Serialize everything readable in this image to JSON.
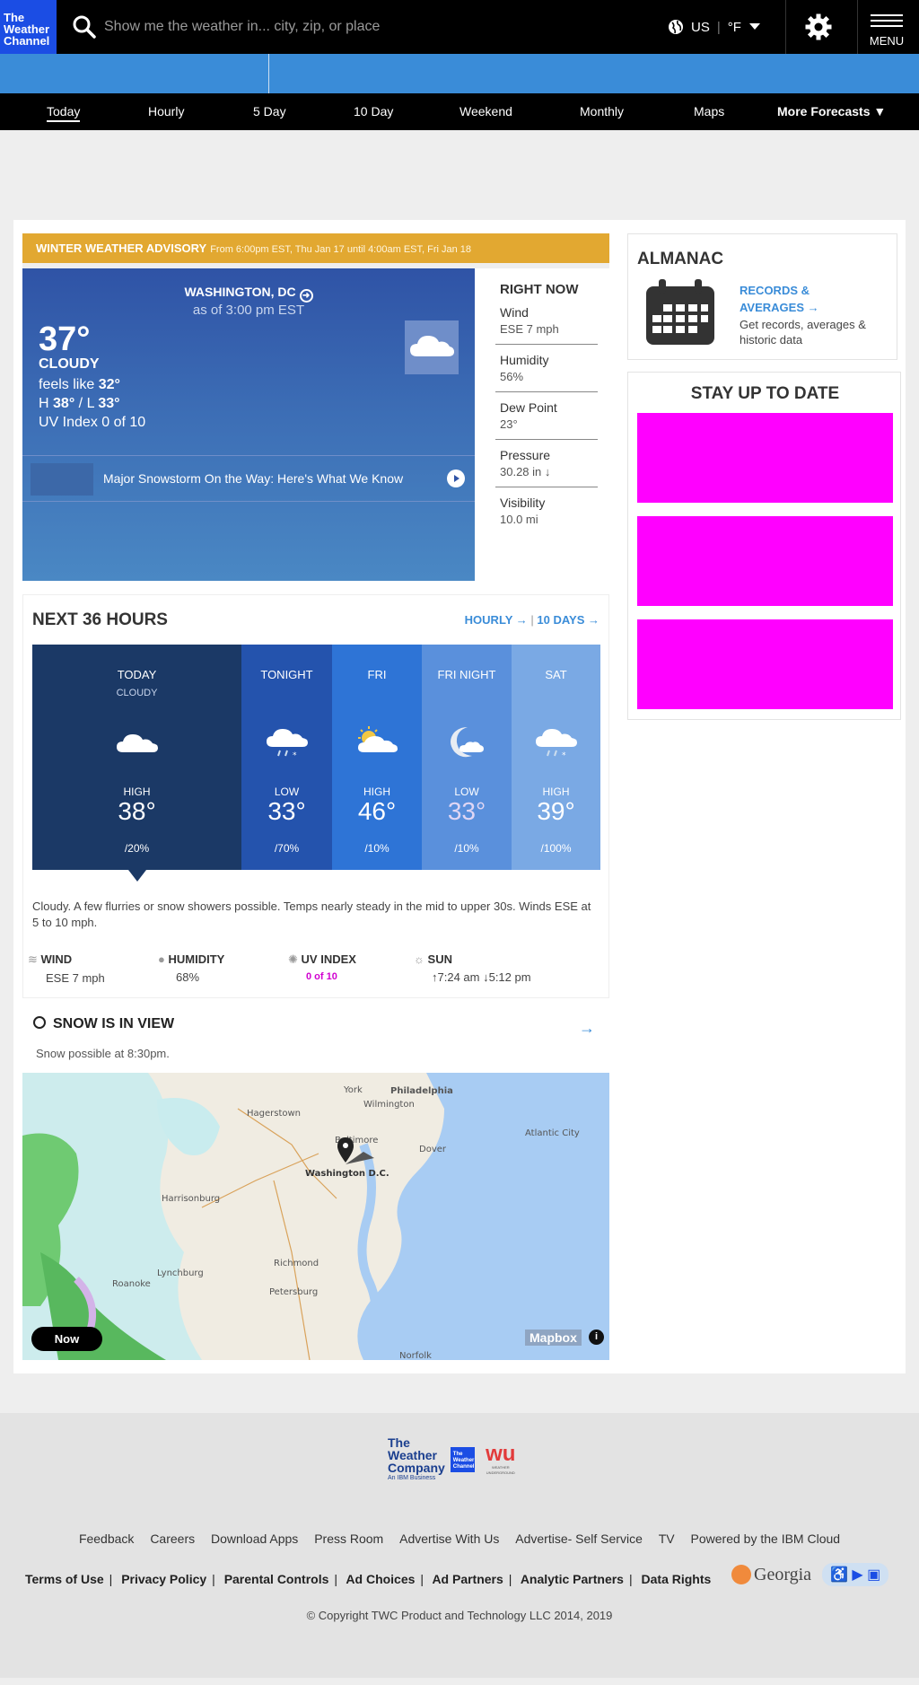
{
  "header": {
    "logo": [
      "The",
      "Weather",
      "Channel"
    ],
    "search_placeholder": "Show me the weather in... city, zip, or place",
    "locale": "US",
    "unit": "°F",
    "menu_label": "MENU"
  },
  "nav": {
    "items": [
      "Today",
      "Hourly",
      "5 Day",
      "10 Day",
      "Weekend",
      "Monthly",
      "Maps",
      "More Forecasts"
    ],
    "active": "Today"
  },
  "advisory": {
    "title": "WINTER WEATHER ADVISORY",
    "detail": "From 6:00pm EST, Thu Jan 17 until 4:00am EST, Fri Jan 18"
  },
  "current": {
    "location": "WASHINGTON, DC",
    "as_of": "as of 3:00 pm EST",
    "temp": "37°",
    "condition": "CLOUDY",
    "feels_like_label": "feels like",
    "feels_like": "32°",
    "high_label": "H",
    "high": "38°",
    "low_label": "L",
    "low": "33°",
    "uv": "UV Index 0 of 10",
    "video_title": "Major Snowstorm On the Way: Here's What We Know",
    "icon": "cloud-icon"
  },
  "right_now": {
    "title": "RIGHT NOW",
    "items": [
      {
        "label": "Wind",
        "value": "ESE 7 mph"
      },
      {
        "label": "Humidity",
        "value": "56%"
      },
      {
        "label": "Dew Point",
        "value": "23°"
      },
      {
        "label": "Pressure",
        "value": "30.28 in ↓"
      },
      {
        "label": "Visibility",
        "value": "10.0 mi"
      }
    ]
  },
  "almanac": {
    "title": "ALMANAC",
    "link": "RECORDS & AVERAGES →",
    "desc": "Get records, averages & historic data"
  },
  "stay": {
    "title": "STAY UP TO DATE"
  },
  "next36": {
    "title": "NEXT 36 HOURS",
    "link_hourly": "HOURLY →",
    "link_10days": "10 DAYS →",
    "periods": [
      {
        "name": "TODAY",
        "condition": "CLOUDY",
        "type": "HIGH",
        "temp": "38°",
        "precip": "20%",
        "color": "#1b3966",
        "icon": "cloud-icon"
      },
      {
        "name": "TONIGHT",
        "condition": "",
        "type": "LOW",
        "temp": "33°",
        "precip": "70%",
        "color": "#2453ad",
        "icon": "snow-cloud-icon"
      },
      {
        "name": "FRI",
        "condition": "",
        "type": "HIGH",
        "temp": "46°",
        "precip": "10%",
        "color": "#2e74d6",
        "icon": "partly-sunny-icon"
      },
      {
        "name": "FRI NIGHT",
        "condition": "",
        "type": "LOW",
        "temp": "33°",
        "precip": "10%",
        "color": "#5a90dc",
        "icon": "moon-icon"
      },
      {
        "name": "SAT",
        "condition": "",
        "type": "HIGH",
        "temp": "39°",
        "precip": "100%",
        "color": "#7aa9e4",
        "icon": "snow-cloud-icon"
      }
    ],
    "narrative": "Cloudy. A few flurries or snow showers possible. Temps nearly steady in the mid to upper 30s. Winds ESE at 5 to 10 mph.",
    "details": [
      {
        "label": "WIND",
        "value": "ESE 7 mph",
        "icon": "wind-icon"
      },
      {
        "label": "HUMIDITY",
        "value": "68%",
        "icon": "humidity-icon"
      },
      {
        "label": "UV INDEX",
        "value": "0 of 10",
        "icon": "uv-icon"
      },
      {
        "label": "SUN",
        "value": "↑7:24 am ↓5:12 pm",
        "icon": "sun-icon"
      }
    ]
  },
  "snow": {
    "title": "SNOW IS IN VIEW",
    "subtitle": "Snow possible at 8:30pm.",
    "now_button": "Now",
    "attribution": "Mapbox",
    "map_labels": [
      "Philadelphia",
      "Wilmington",
      "York",
      "Hagerstown",
      "Baltimore",
      "Dover",
      "Atlantic City",
      "Washington D.C.",
      "Harrisonburg",
      "Richmond",
      "Lynchburg",
      "Petersburg",
      "Roanoke",
      "Norfolk"
    ]
  },
  "footer": {
    "links": [
      "Feedback",
      "Careers",
      "Download Apps",
      "Press Room",
      "Advertise With Us",
      "Advertise- Self Service",
      "TV",
      "Powered by the IBM Cloud"
    ],
    "legal": [
      "Terms of Use",
      "Privacy Policy",
      "Parental Controls",
      "Ad Choices",
      "Ad Partners",
      "Analytic Partners",
      "Data Rights"
    ],
    "copyright": "© Copyright TWC Product and Technology LLC 2014, 2019",
    "logo_company": [
      "The",
      "Weather",
      "Company"
    ],
    "logo_company_sub": "An IBM Business",
    "logo_twc": [
      "The",
      "Weather",
      "Channel"
    ],
    "logo_wu": "wu",
    "logo_wu_sub": "WEATHER UNDERGROUND",
    "georgia": "Georgia"
  }
}
